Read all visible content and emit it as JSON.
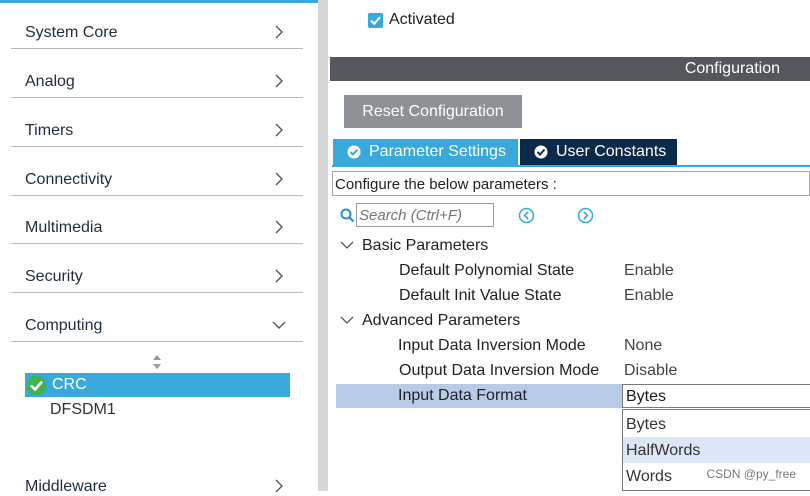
{
  "sidebar": {
    "categories": [
      {
        "label": "System Core",
        "icon": "chevron-right-icon"
      },
      {
        "label": "Analog",
        "icon": "chevron-right-icon"
      },
      {
        "label": "Timers",
        "icon": "chevron-right-icon"
      },
      {
        "label": "Connectivity",
        "icon": "chevron-right-icon"
      },
      {
        "label": "Multimedia",
        "icon": "chevron-right-icon"
      },
      {
        "label": "Security",
        "icon": "chevron-right-icon"
      },
      {
        "label": "Computing",
        "icon": "chevron-down-icon"
      },
      {
        "label": "Middleware",
        "icon": "chevron-right-icon"
      }
    ],
    "computing_items": [
      {
        "label": "CRC",
        "selected": true,
        "status": "checked"
      },
      {
        "label": "DFSDM1",
        "selected": false
      }
    ]
  },
  "mode": {
    "activated_label": "Activated",
    "activated": true
  },
  "configuration": {
    "header": "Configuration",
    "reset_button": "Reset Configuration",
    "tabs": [
      {
        "label": "Parameter Settings",
        "active": true
      },
      {
        "label": "User Constants",
        "active": false
      }
    ],
    "instructions": "Configure the below parameters :",
    "search_placeholder": "Search (Ctrl+F)",
    "groups": [
      {
        "label": "Basic Parameters",
        "params": [
          {
            "name": "Default Polynomial State",
            "value": "Enable"
          },
          {
            "name": "Default Init Value State",
            "value": "Enable"
          }
        ]
      },
      {
        "label": "Advanced Parameters",
        "params": [
          {
            "name": "Input Data Inversion Mode",
            "value": "None"
          },
          {
            "name": "Output Data Inversion Mode",
            "value": "Disable"
          },
          {
            "name": "Input Data Format",
            "value": "Bytes"
          }
        ]
      }
    ],
    "dropdown_options": [
      "Bytes",
      "HalfWords",
      "Words"
    ],
    "dropdown_highlighted": "HalfWords"
  },
  "watermark": "CSDN @py_free",
  "colors": {
    "accent": "#39a9dc",
    "dark_tab": "#0b2a4a",
    "header": "#54575b",
    "selection": "#b8cce8"
  }
}
